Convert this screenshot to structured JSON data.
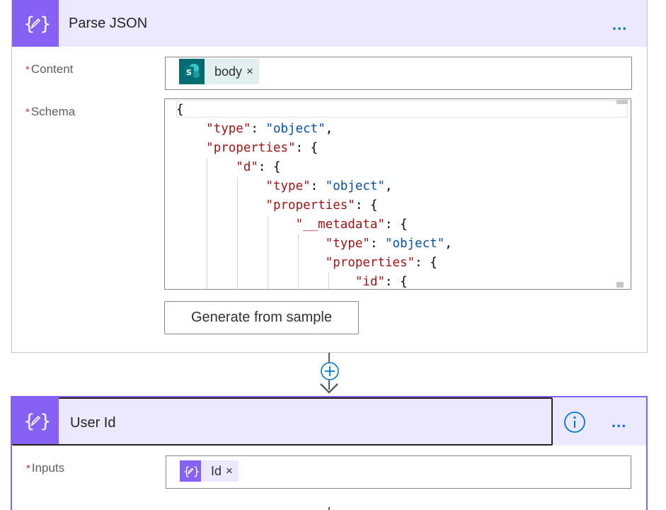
{
  "parse_json": {
    "title": "Parse JSON",
    "more_label": "...",
    "content_label": "Content",
    "content_token": {
      "text": "body",
      "remove": "×",
      "icon": "sharepoint-icon",
      "color": "#036c70"
    },
    "schema_label": "Schema",
    "required_mark": "*",
    "schema_lines": [
      "{",
      "    \"type\": \"object\",",
      "    \"properties\": {",
      "        \"d\": {",
      "            \"type\": \"object\",",
      "            \"properties\": {",
      "                \"__metadata\": {",
      "                    \"type\": \"object\",",
      "                    \"properties\": {",
      "                        \"id\": {"
    ],
    "generate_button": "Generate from sample"
  },
  "user_id": {
    "title": "User Id",
    "more_label": "...",
    "inputs_label": "Inputs",
    "required_mark": "*",
    "inputs_token": {
      "text": "Id",
      "remove": "×",
      "icon": "data-operation-icon"
    }
  },
  "colors": {
    "accent": "#8661f5",
    "header_bg": "#ece8fd",
    "link": "#0078d4",
    "required": "#c4314b"
  }
}
